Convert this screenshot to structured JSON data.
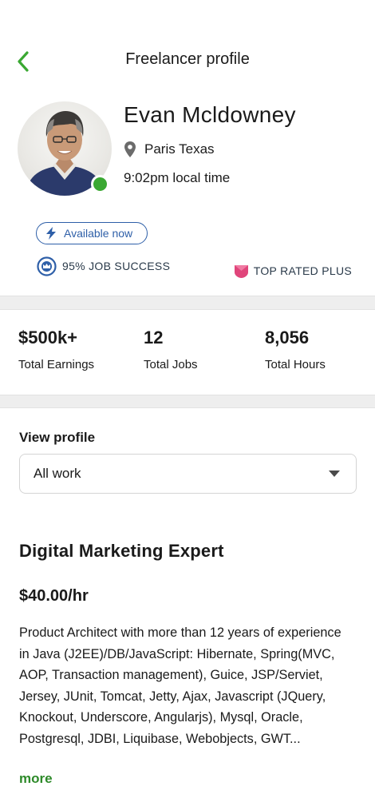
{
  "header": {
    "title": "Freelancer profile"
  },
  "profile": {
    "name": "Evan Mcldowney",
    "location": "Paris Texas",
    "local_time": "9:02pm local time",
    "availability": "Available now",
    "job_success": "95% JOB SUCCESS",
    "badge": "TOP RATED PLUS",
    "online_color": "#3aa832"
  },
  "stats": [
    {
      "value": "$500k+",
      "label": "Total Earnings"
    },
    {
      "value": "12",
      "label": "Total Jobs"
    },
    {
      "value": "8,056",
      "label": "Total Hours"
    }
  ],
  "detail": {
    "view_label": "View profile",
    "select_value": "All work",
    "title": "Digital Marketing Expert",
    "rate": "$40.00/hr",
    "description": "Product Architect with more than 12 years of experience in Java (J2EE)/DB/JavaScript: Hibernate, Spring(MVC, AOP, Transaction management), Guice, JSP/Serviet, Jersey, JUnit, Tomcat, Jetty, Ajax, Javascript (JQuery, Knockout, Underscore, Angularjs), Mysql, Oracle, Postgresql, JDBI, Liquibase, Webobjects, GWT...",
    "more": "more"
  },
  "icons": {
    "back": "chevron-left-icon",
    "location": "map-pin-icon",
    "availability": "lightning-bolt-icon",
    "job_success": "crown-badge-icon",
    "top_rated": "shield-badge-icon",
    "dropdown": "caret-down-icon"
  },
  "colors": {
    "accent_green": "#3aa832",
    "link_blue": "#2e5fa8",
    "badge_pink": "#e0457b"
  }
}
